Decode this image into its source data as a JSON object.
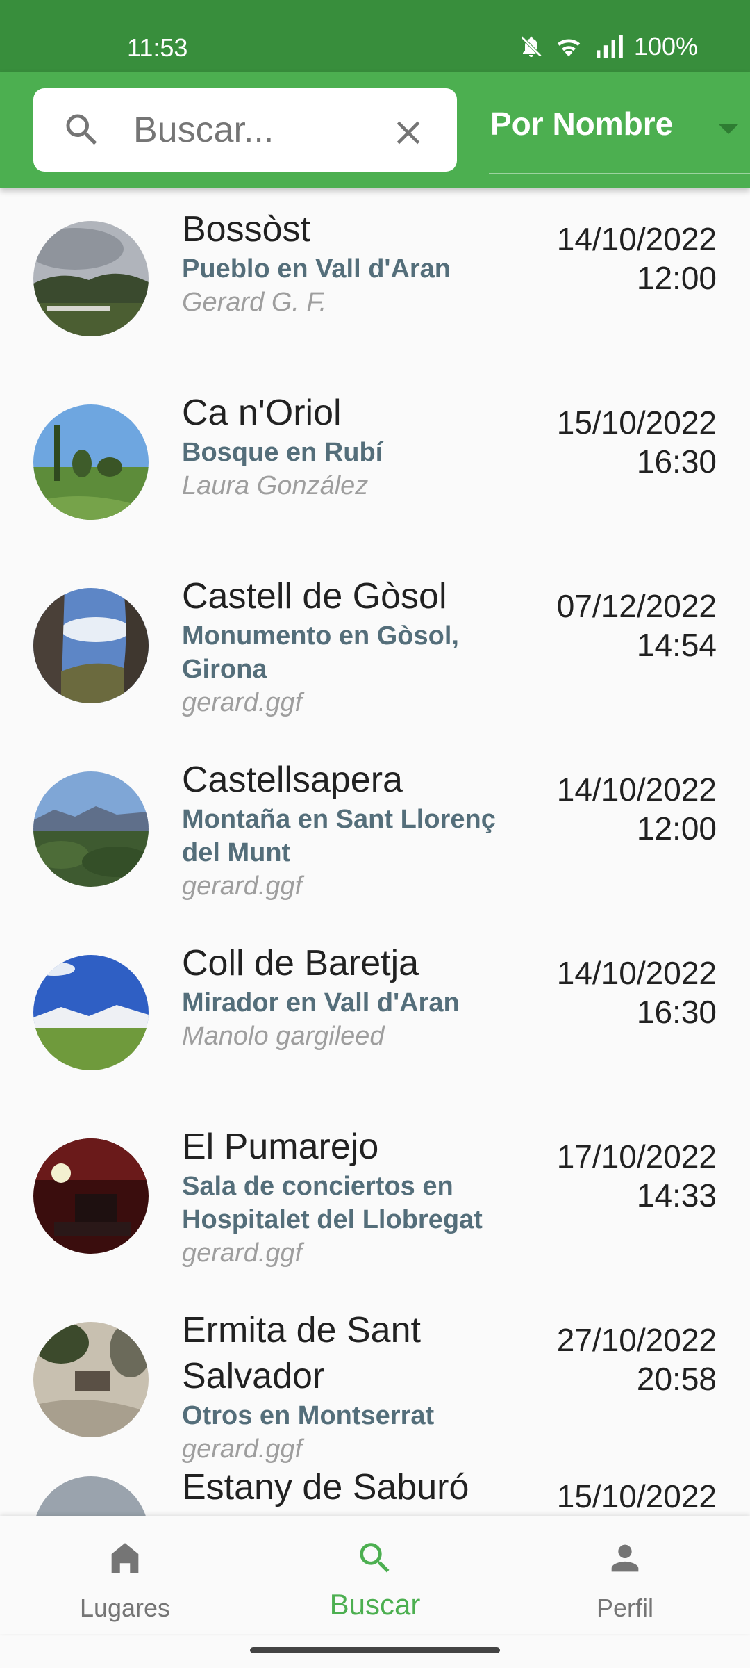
{
  "status_bar": {
    "time": "11:53",
    "battery": "100%",
    "icons": [
      "mute-icon",
      "wifi-icon",
      "signal-icon"
    ]
  },
  "search": {
    "placeholder": "Buscar...",
    "value": ""
  },
  "sort": {
    "selected": "Por Nombre"
  },
  "places": [
    {
      "name": "Bossòst",
      "subtitle": "Pueblo en Vall d'Aran",
      "author": "Gerard G. F.",
      "date": "14/10/2022",
      "time": "12:00"
    },
    {
      "name": "Ca n'Oriol",
      "subtitle": "Bosque en Rubí",
      "author": "Laura González",
      "date": "15/10/2022",
      "time": "16:30"
    },
    {
      "name": "Castell de Gòsol",
      "subtitle": "Monumento en Gòsol, Girona",
      "author": "gerard.ggf",
      "date": "07/12/2022",
      "time": "14:54"
    },
    {
      "name": "Castellsapera",
      "subtitle": "Montaña en Sant Llorenç del Munt",
      "author": "gerard.ggf",
      "date": "14/10/2022",
      "time": "12:00"
    },
    {
      "name": "Coll de Baretja",
      "subtitle": "Mirador en Vall d'Aran",
      "author": "Manolo gargileed",
      "date": "14/10/2022",
      "time": "16:30"
    },
    {
      "name": "El Pumarejo",
      "subtitle": "Sala de conciertos en Hospitalet del Llobregat",
      "author": "gerard.ggf",
      "date": "17/10/2022",
      "time": "14:33"
    },
    {
      "name": "Ermita de Sant Salvador",
      "subtitle": "Otros en Montserrat",
      "author": "gerard.ggf",
      "date": "27/10/2022",
      "time": "20:58"
    },
    {
      "name": "Estany de Saburó",
      "subtitle": "",
      "author": "",
      "date": "15/10/2022",
      "time": ""
    }
  ],
  "bottom_nav": {
    "items": [
      {
        "label": "Lugares",
        "icon": "home-icon"
      },
      {
        "label": "Buscar",
        "icon": "search-icon",
        "active": true
      },
      {
        "label": "Perfil",
        "icon": "person-icon"
      }
    ]
  },
  "colors": {
    "status_bar": "#388e3c",
    "app_bar": "#4caf50",
    "accent": "#4caf50",
    "subtitle": "#546e7a",
    "author": "#9e9e9e"
  }
}
